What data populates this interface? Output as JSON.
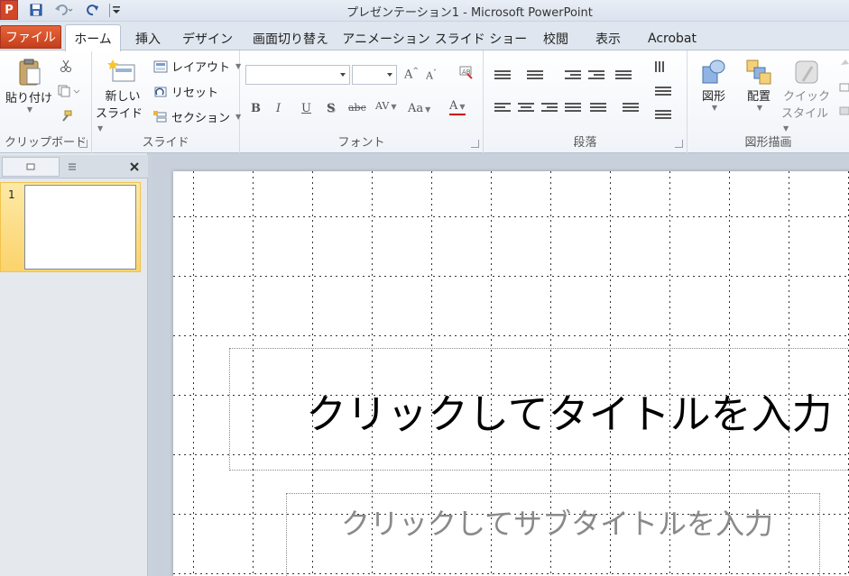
{
  "window": {
    "title": "プレゼンテーション1  -  Microsoft PowerPoint",
    "app_icon_letter": "P"
  },
  "quick_access": {
    "save_icon": "save-icon",
    "undo_icon": "undo-icon",
    "redo_icon": "redo-icon",
    "customize_icon": "customize-icon"
  },
  "tabs": [
    {
      "label": "ファイル"
    },
    {
      "label": "ホーム"
    },
    {
      "label": "挿入"
    },
    {
      "label": "デザイン"
    },
    {
      "label": "画面切り替え"
    },
    {
      "label": "アニメーション"
    },
    {
      "label": "スライド ショー"
    },
    {
      "label": "校閲"
    },
    {
      "label": "表示"
    },
    {
      "label": "Acrobat"
    }
  ],
  "ribbon": {
    "clipboard": {
      "group_label": "クリップボード",
      "paste_label": "貼り付け"
    },
    "slides": {
      "group_label": "スライド",
      "new_slide_line1": "新しい",
      "new_slide_line2": "スライド",
      "layout_label": "レイアウト",
      "reset_label": "リセット",
      "section_label": "セクション"
    },
    "font": {
      "group_label": "フォント",
      "font_name": "",
      "font_size": "",
      "bold": "B",
      "italic": "I",
      "underline": "U",
      "shadow": "S",
      "strike": "abc",
      "spacing": "AV",
      "case": "Aa",
      "color": "A",
      "grow": "A",
      "shrink": "A"
    },
    "paragraph": {
      "group_label": "段落"
    },
    "drawing": {
      "group_label": "図形描画",
      "shapes_label": "図形",
      "arrange_label": "配置",
      "quick_styles_line1": "クイック",
      "quick_styles_line2": "スタイル"
    }
  },
  "slides_panel": {
    "slide_number": "1"
  },
  "slide": {
    "title_placeholder": "クリックしてタイトルを入力",
    "subtitle_placeholder": "クリックしてサブタイトルを入力"
  }
}
